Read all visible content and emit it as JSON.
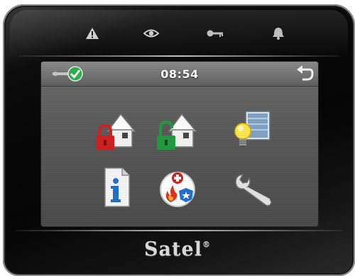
{
  "status_bar": {
    "time": "08:54"
  },
  "indicators": [
    {
      "icon": "alarm-warning-icon"
    },
    {
      "icon": "eye-icon"
    },
    {
      "icon": "key-icon"
    },
    {
      "icon": "bell-icon"
    }
  ],
  "menu": [
    {
      "icon": "arm-house-locked-icon"
    },
    {
      "icon": "disarm-house-unlocked-icon"
    },
    {
      "icon": "lighting-control-icon"
    },
    {
      "icon": "information-icon"
    },
    {
      "icon": "emergency-fire-medical-icon"
    },
    {
      "icon": "service-wrench-icon"
    }
  ],
  "brand": {
    "name": "Satel",
    "mark": "®"
  },
  "colors": {
    "lock_red": "#d21f1f",
    "lock_green": "#1f9a3c",
    "check_green": "#2bb34a",
    "info_blue": "#1f6fd1"
  }
}
